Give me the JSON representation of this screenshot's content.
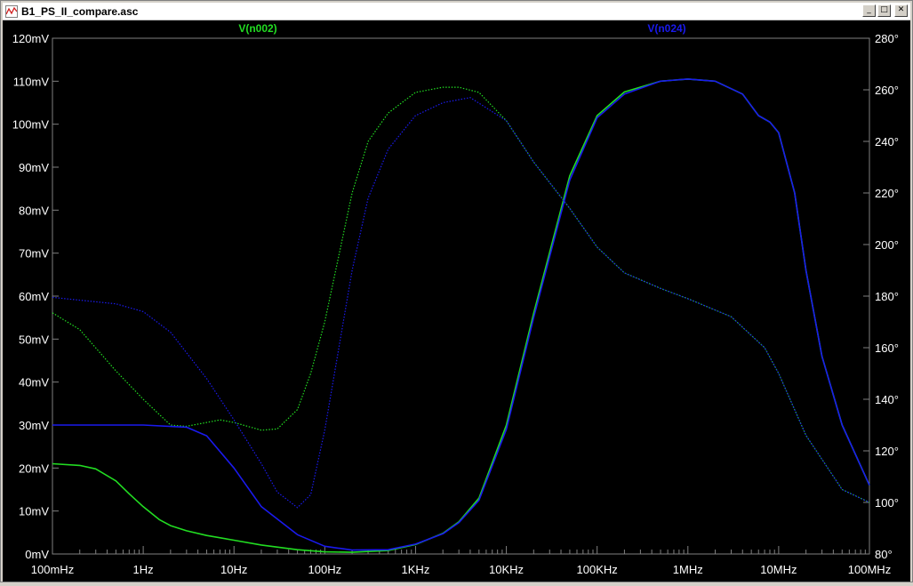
{
  "window": {
    "title": "B1_PS_II_compare.asc",
    "icons": {
      "app": "waveform-icon",
      "minimize": "minimize-icon",
      "maximize": "maximize-icon",
      "close": "close-icon"
    },
    "buttons": {
      "minimize": "_",
      "maximize": "□",
      "close": "✕"
    }
  },
  "chart_data": {
    "type": "line",
    "x_scale": "log",
    "xlim": [
      0.1,
      100000000
    ],
    "x_ticks": [
      {
        "value": 0.1,
        "label": "100mHz"
      },
      {
        "value": 1,
        "label": "1Hz"
      },
      {
        "value": 10,
        "label": "10Hz"
      },
      {
        "value": 100,
        "label": "100Hz"
      },
      {
        "value": 1000,
        "label": "1KHz"
      },
      {
        "value": 10000,
        "label": "10KHz"
      },
      {
        "value": 100000,
        "label": "100KHz"
      },
      {
        "value": 1000000,
        "label": "1MHz"
      },
      {
        "value": 10000000,
        "label": "10MHz"
      },
      {
        "value": 100000000,
        "label": "100MHz"
      }
    ],
    "ylim_left": [
      0,
      120
    ],
    "y_left_ticks": [
      {
        "value": 0,
        "label": "0mV"
      },
      {
        "value": 10,
        "label": "10mV"
      },
      {
        "value": 20,
        "label": "20mV"
      },
      {
        "value": 30,
        "label": "30mV"
      },
      {
        "value": 40,
        "label": "40mV"
      },
      {
        "value": 50,
        "label": "50mV"
      },
      {
        "value": 60,
        "label": "60mV"
      },
      {
        "value": 70,
        "label": "70mV"
      },
      {
        "value": 80,
        "label": "80mV"
      },
      {
        "value": 90,
        "label": "90mV"
      },
      {
        "value": 100,
        "label": "100mV"
      },
      {
        "value": 110,
        "label": "110mV"
      },
      {
        "value": 120,
        "label": "120mV"
      }
    ],
    "ylim_right": [
      80,
      280
    ],
    "y_right_ticks": [
      {
        "value": 80,
        "label": "80°"
      },
      {
        "value": 100,
        "label": "100°"
      },
      {
        "value": 120,
        "label": "120°"
      },
      {
        "value": 140,
        "label": "140°"
      },
      {
        "value": 160,
        "label": "160°"
      },
      {
        "value": 180,
        "label": "180°"
      },
      {
        "value": 200,
        "label": "200°"
      },
      {
        "value": 220,
        "label": "220°"
      },
      {
        "value": 240,
        "label": "240°"
      },
      {
        "value": 260,
        "label": "260°"
      },
      {
        "value": 280,
        "label": "280°"
      }
    ],
    "grid": false,
    "background": "#000000",
    "axis_color": "#808080",
    "tick_label_color": "#ffffff",
    "series": [
      {
        "name": "V(n002)",
        "color": "#22dd22",
        "legend_position": "top-center-left",
        "magnitude_mV": [
          [
            0.1,
            21
          ],
          [
            0.2,
            20.6
          ],
          [
            0.3,
            19.8
          ],
          [
            0.5,
            17
          ],
          [
            0.7,
            14
          ],
          [
            1,
            11
          ],
          [
            1.5,
            8
          ],
          [
            2,
            6.6
          ],
          [
            3,
            5.4
          ],
          [
            5,
            4.3
          ],
          [
            10,
            3.2
          ],
          [
            20,
            2.1
          ],
          [
            50,
            1
          ],
          [
            100,
            0.5
          ],
          [
            200,
            0.4
          ],
          [
            500,
            0.8
          ],
          [
            1000,
            2.2
          ],
          [
            2000,
            4.8
          ],
          [
            3000,
            7.5
          ],
          [
            5000,
            13
          ],
          [
            10000,
            30
          ],
          [
            20000,
            56
          ],
          [
            50000,
            88
          ],
          [
            100000,
            102
          ],
          [
            200000,
            107.5
          ],
          [
            500000,
            110
          ],
          [
            1000000,
            110.5
          ],
          [
            2000000,
            110
          ],
          [
            4000000,
            107
          ],
          [
            6000000,
            102
          ],
          [
            8000000,
            100.5
          ],
          [
            10000000,
            98
          ],
          [
            15000000,
            84
          ],
          [
            20000000,
            66
          ],
          [
            30000000,
            46
          ],
          [
            50000000,
            30
          ],
          [
            100000000,
            16
          ]
        ],
        "phase_deg": [
          [
            0.1,
            173.5
          ],
          [
            0.2,
            167
          ],
          [
            0.5,
            151
          ],
          [
            1,
            140
          ],
          [
            2,
            130
          ],
          [
            3,
            129.5
          ],
          [
            5,
            131
          ],
          [
            7,
            132
          ],
          [
            10,
            131
          ],
          [
            20,
            128
          ],
          [
            30,
            128.5
          ],
          [
            50,
            136
          ],
          [
            70,
            150
          ],
          [
            100,
            170
          ],
          [
            200,
            220
          ],
          [
            300,
            240
          ],
          [
            500,
            251
          ],
          [
            1000,
            259
          ],
          [
            2000,
            261
          ],
          [
            3000,
            261
          ],
          [
            5000,
            259
          ],
          [
            10000,
            248
          ],
          [
            20000,
            232
          ],
          [
            50000,
            214
          ],
          [
            100000,
            199
          ],
          [
            200000,
            189
          ],
          [
            500000,
            183
          ],
          [
            1000000,
            179
          ],
          [
            3000000,
            172
          ],
          [
            7000000,
            160
          ],
          [
            10000000,
            150
          ],
          [
            20000000,
            126
          ],
          [
            50000000,
            105
          ],
          [
            100000000,
            100
          ]
        ]
      },
      {
        "name": "V(n024)",
        "color": "#1a1aee",
        "legend_position": "top-center-right",
        "magnitude_mV": [
          [
            0.1,
            30
          ],
          [
            1,
            30
          ],
          [
            3,
            29.5
          ],
          [
            5,
            27.5
          ],
          [
            10,
            20
          ],
          [
            20,
            11
          ],
          [
            50,
            4.5
          ],
          [
            100,
            1.8
          ],
          [
            200,
            0.9
          ],
          [
            500,
            1
          ],
          [
            1000,
            2.3
          ],
          [
            2000,
            4.7
          ],
          [
            3000,
            7.3
          ],
          [
            5000,
            12.5
          ],
          [
            10000,
            29
          ],
          [
            20000,
            55
          ],
          [
            50000,
            87
          ],
          [
            100000,
            101.5
          ],
          [
            200000,
            107
          ],
          [
            500000,
            110
          ],
          [
            1000000,
            110.5
          ],
          [
            2000000,
            110
          ],
          [
            4000000,
            107
          ],
          [
            6000000,
            102
          ],
          [
            8000000,
            100.5
          ],
          [
            10000000,
            98
          ],
          [
            15000000,
            84
          ],
          [
            20000000,
            66
          ],
          [
            30000000,
            46
          ],
          [
            50000000,
            30
          ],
          [
            100000000,
            16
          ]
        ],
        "phase_deg": [
          [
            0.1,
            179.5
          ],
          [
            0.5,
            177
          ],
          [
            1,
            174
          ],
          [
            2,
            166
          ],
          [
            5,
            148
          ],
          [
            10,
            132
          ],
          [
            20,
            115
          ],
          [
            30,
            104
          ],
          [
            50,
            98
          ],
          [
            70,
            103
          ],
          [
            100,
            128
          ],
          [
            200,
            190
          ],
          [
            300,
            218
          ],
          [
            500,
            237
          ],
          [
            1000,
            250
          ],
          [
            2000,
            255
          ],
          [
            4000,
            257
          ],
          [
            10000,
            248
          ],
          [
            20000,
            232
          ],
          [
            50000,
            214
          ],
          [
            100000,
            199
          ],
          [
            200000,
            189
          ],
          [
            500000,
            183
          ],
          [
            1000000,
            179
          ],
          [
            3000000,
            172
          ],
          [
            7000000,
            160
          ],
          [
            10000000,
            150
          ],
          [
            20000000,
            126
          ],
          [
            50000000,
            105
          ],
          [
            100000000,
            100
          ]
        ]
      }
    ]
  }
}
